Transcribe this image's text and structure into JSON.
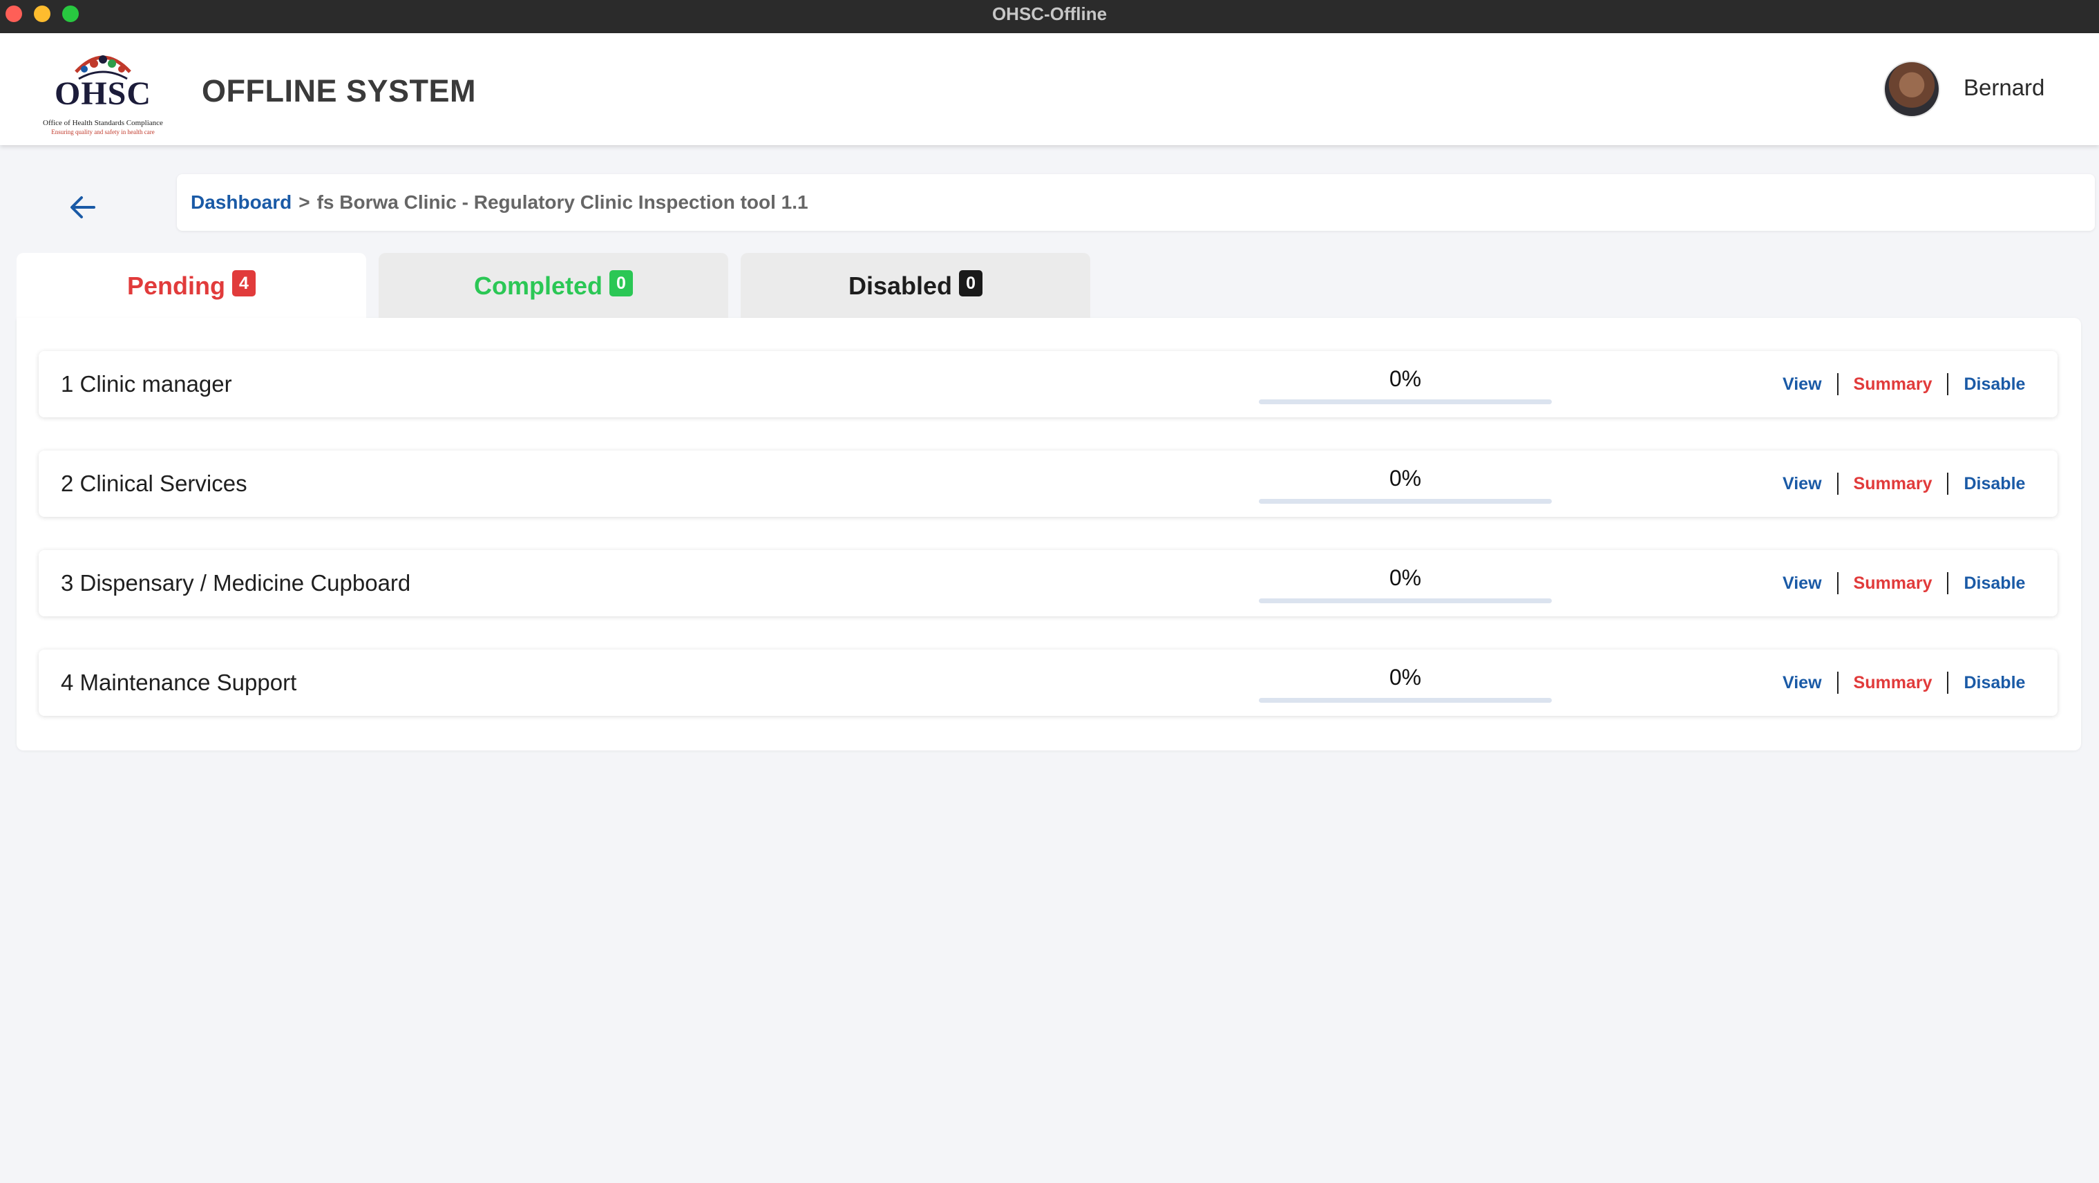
{
  "window": {
    "title": "OHSC-Offline"
  },
  "header": {
    "logo_text": "OHSC",
    "logo_subtitle": "Office of Health Standards Compliance",
    "logo_tagline": "Ensuring quality and safety in health care",
    "app_title": "OFFLINE SYSTEM",
    "user_name": "Bernard"
  },
  "breadcrumb": {
    "root": "Dashboard",
    "separator": ">",
    "current": "fs Borwa Clinic - Regulatory Clinic Inspection tool 1.1"
  },
  "tabs": [
    {
      "label": "Pending",
      "count": "4",
      "active": true,
      "color": "#e13b3b"
    },
    {
      "label": "Completed",
      "count": "0",
      "active": false,
      "color": "#2bc755"
    },
    {
      "label": "Disabled",
      "count": "0",
      "active": false,
      "color": "#1d1d1d"
    }
  ],
  "items": [
    {
      "name": "1 Clinic manager",
      "progress_label": "0%",
      "progress": 0,
      "view": "View",
      "summary": "Summary",
      "disable": "Disable"
    },
    {
      "name": "2 Clinical Services",
      "progress_label": "0%",
      "progress": 0,
      "view": "View",
      "summary": "Summary",
      "disable": "Disable"
    },
    {
      "name": "3 Dispensary / Medicine Cupboard",
      "progress_label": "0%",
      "progress": 0,
      "view": "View",
      "summary": "Summary",
      "disable": "Disable"
    },
    {
      "name": "4 Maintenance Support",
      "progress_label": "0%",
      "progress": 0,
      "view": "View",
      "summary": "Summary",
      "disable": "Disable"
    }
  ],
  "colors": {
    "accent_blue": "#1a5aa6",
    "danger_red": "#e13b3b",
    "success_green": "#2bc755"
  }
}
